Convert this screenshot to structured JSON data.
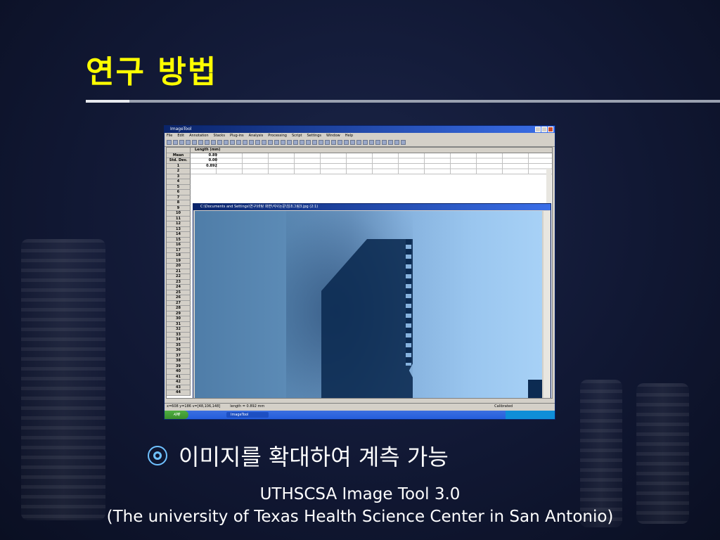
{
  "slide": {
    "title": "연구 방법",
    "bullet": "이미지를 확대하여 계측 가능",
    "credit_line1": "UTHSCSA Image Tool 3.0",
    "credit_line2": "(The university of Texas Health Science Center in San Antonio)"
  },
  "screenshot": {
    "app_title": "ImageTool",
    "menus": [
      "File",
      "Edit",
      "Annotation",
      "Stacks",
      "Plug-ins",
      "Analysis",
      "Processing",
      "Script",
      "Settings",
      "Window",
      "Help"
    ],
    "sheet": {
      "column_header": "Length (mm)",
      "stat_rows": [
        {
          "label": "Mean",
          "value": "0.89"
        },
        {
          "label": "Std. Dev.",
          "value": "0.00"
        },
        {
          "label": "1",
          "value": "0.892"
        }
      ],
      "row_numbers": [
        "2",
        "3",
        "4",
        "5",
        "6",
        "7",
        "8",
        "9",
        "10",
        "11",
        "12",
        "13",
        "14",
        "15",
        "16",
        "17",
        "18",
        "19",
        "20",
        "21",
        "22",
        "23",
        "24",
        "25",
        "26",
        "27",
        "28",
        "29",
        "30",
        "31",
        "32",
        "33",
        "34",
        "35",
        "36",
        "37",
        "38",
        "39",
        "40",
        "41",
        "42",
        "43",
        "44"
      ]
    },
    "image_window_title": "C:\\Documents and Settings\\연구\\바탕 화면\\석사논문\\임조그림3.jpg (2:1)",
    "status": {
      "coords": "x=608 y=186 v=[48,106,148]",
      "length": "length = 0.892 mm",
      "calibrated": "Calibrated"
    },
    "taskbar": {
      "start": "시작",
      "item": "ImageTool"
    }
  },
  "colors": {
    "title": "#ffff00",
    "bullet_icon": "#6fc1ff",
    "background": "#111834"
  }
}
